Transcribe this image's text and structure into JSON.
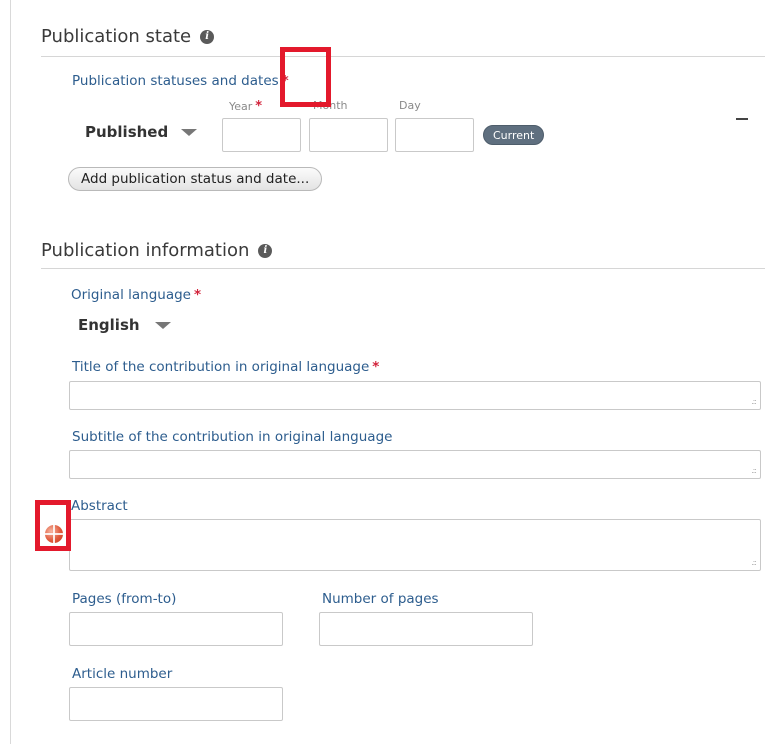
{
  "publication_state": {
    "title": "Publication state",
    "statuses_label": "Publication statuses and dates",
    "required_mark": "*",
    "year_label": "Year",
    "month_label": "Month",
    "day_label": "Day",
    "status_value": "Published",
    "year_value": "",
    "month_value": "",
    "day_value": "",
    "current_label": "Current",
    "add_button_label": "Add publication status and date..."
  },
  "publication_information": {
    "title": "Publication information",
    "original_language_label": "Original language",
    "language_value": "English",
    "title_label": "Title of the contribution in original language",
    "subtitle_label": "Subtitle of the contribution in original language",
    "abstract_label": "Abstract",
    "pages_label": "Pages (from-to)",
    "number_of_pages_label": "Number of pages",
    "article_number_label": "Article number"
  },
  "icons": {
    "info": "info-icon",
    "language": "globe-flag-icon",
    "remove": "minus-icon",
    "dropdown": "caret-down-icon"
  },
  "colors": {
    "label_blue": "#2d5d8e",
    "required_red": "#d2233b",
    "highlight_red": "#e3192c",
    "pill_gray": "#5f6f7f"
  }
}
